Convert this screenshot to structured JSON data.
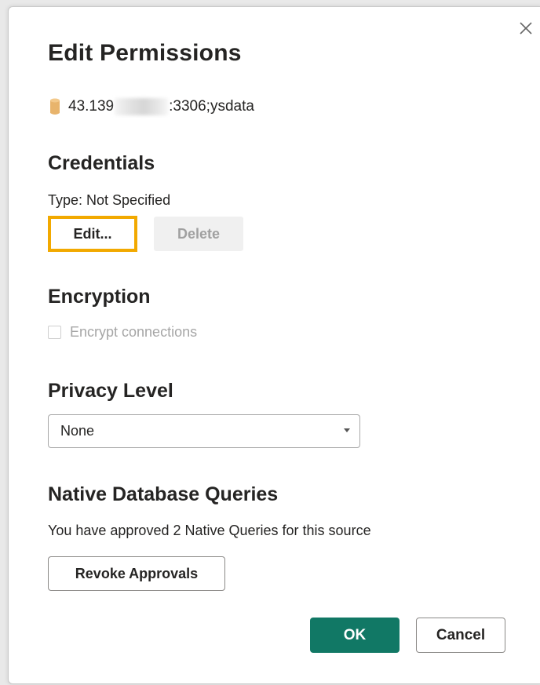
{
  "dialog": {
    "title": "Edit Permissions",
    "close_icon": "close-icon",
    "source": {
      "icon": "database-icon",
      "icon_color": "#E8B46C",
      "prefix": "43.139",
      "suffix": ":3306;ysdata"
    }
  },
  "credentials": {
    "heading": "Credentials",
    "type_text": "Type: Not Specified",
    "edit_label": "Edit...",
    "delete_label": "Delete",
    "highlight_color": "#F2A900"
  },
  "encryption": {
    "heading": "Encryption",
    "checkbox_label": "Encrypt connections",
    "checked": false,
    "enabled": false
  },
  "privacy": {
    "heading": "Privacy Level",
    "selected": "None"
  },
  "native_queries": {
    "heading": "Native Database Queries",
    "status_text": "You have approved 2 Native Queries for this source",
    "revoke_label": "Revoke Approvals"
  },
  "footer": {
    "ok_label": "OK",
    "cancel_label": "Cancel",
    "accent_color": "#117865"
  }
}
